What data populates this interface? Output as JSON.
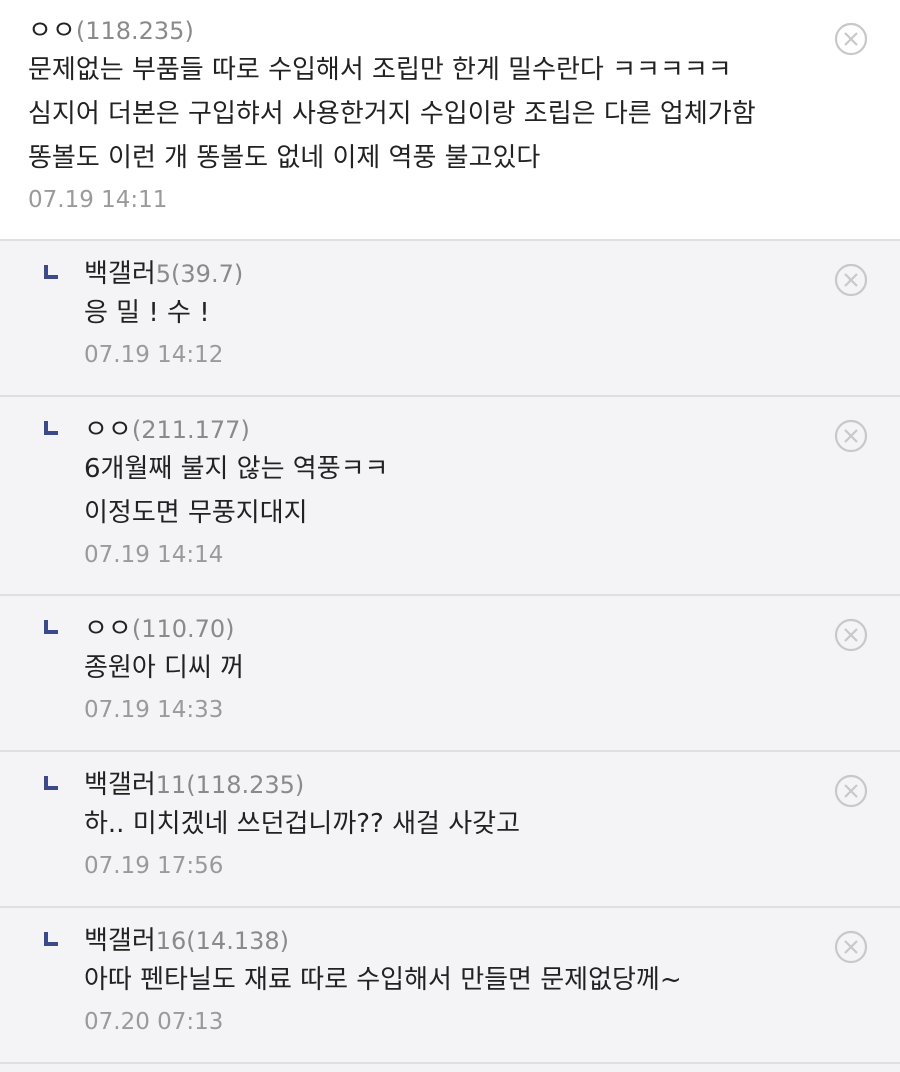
{
  "comments": [
    {
      "nick": "ㅇㅇ",
      "ip": "(118.235)",
      "lines": [
        "문제없는 부품들 따로 수입해서 조립만 한게 밀수란다 ㅋㅋㅋㅋㅋ",
        "심지어 더본은 구입햐서 사용한거지 수입이랑 조립은 다른 업체가함",
        "똥볼도 이런 개 똥볼도 없네 이제 역풍 불고있다"
      ],
      "date": "07.19 14:11"
    }
  ],
  "replies": [
    {
      "nick": "백갤러",
      "ip": "5(39.7)",
      "lines": [
        "응 밀 ! 수 !"
      ],
      "date": "07.19 14:12"
    },
    {
      "nick": "ㅇㅇ",
      "ip": "(211.177)",
      "lines": [
        "6개월째 불지 않는 역풍ㅋㅋ",
        "이정도면 무풍지대지"
      ],
      "date": "07.19 14:14"
    },
    {
      "nick": "ㅇㅇ",
      "ip": "(110.70)",
      "lines": [
        "종원아 디씨 꺼"
      ],
      "date": "07.19 14:33"
    },
    {
      "nick": "백갤러",
      "ip": "11(118.235)",
      "lines": [
        "하.. 미치겠네 쓰던겁니까?? 새걸 사갖고"
      ],
      "date": "07.19 17:56"
    },
    {
      "nick": "백갤러",
      "ip": "16(14.138)",
      "lines": [
        "아따 펜타닐도 재료 따로 수입해서 만들면 문제없당께~"
      ],
      "date": "07.20 07:13"
    }
  ],
  "icons": {
    "delete": "close-circle-icon",
    "reply": "reply-arrow-icon"
  },
  "colors": {
    "reply_arrow": "#3d4a8a",
    "ip_text": "#8a8a8a",
    "date_text": "#9a9a9a",
    "delete_icon": "#c8c8c8"
  }
}
